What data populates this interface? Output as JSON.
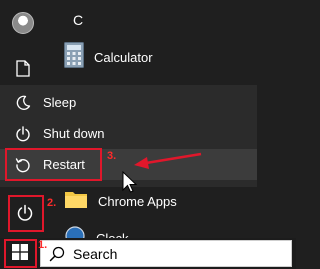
{
  "rail": {
    "avatar_icon": "user-avatar-icon",
    "documents_icon": "document-icon",
    "power_icon": "power-icon"
  },
  "app_list": {
    "section_letter": "C",
    "apps": [
      {
        "label": "Calculator",
        "icon": "calculator-icon"
      },
      {
        "label": "Chrome Apps",
        "icon": "folder-icon"
      },
      {
        "label": "Clock",
        "icon": "clock-icon"
      }
    ]
  },
  "power_menu": {
    "items": [
      {
        "label": "Sleep",
        "icon": "moon-icon"
      },
      {
        "label": "Shut down",
        "icon": "power-icon"
      },
      {
        "label": "Restart",
        "icon": "restart-icon",
        "highlighted": true
      }
    ]
  },
  "taskbar": {
    "start_icon": "windows-logo-icon",
    "search_placeholder": "Search"
  },
  "annotations": {
    "step1": "1.",
    "step2": "2.",
    "step3": "3.",
    "color": "#e0172b"
  },
  "colors": {
    "menu_bg": "#1f1f1f",
    "flyout_bg": "#2b2b2b",
    "hover_bg": "#3c3c3c",
    "folder": "#f2c744"
  }
}
